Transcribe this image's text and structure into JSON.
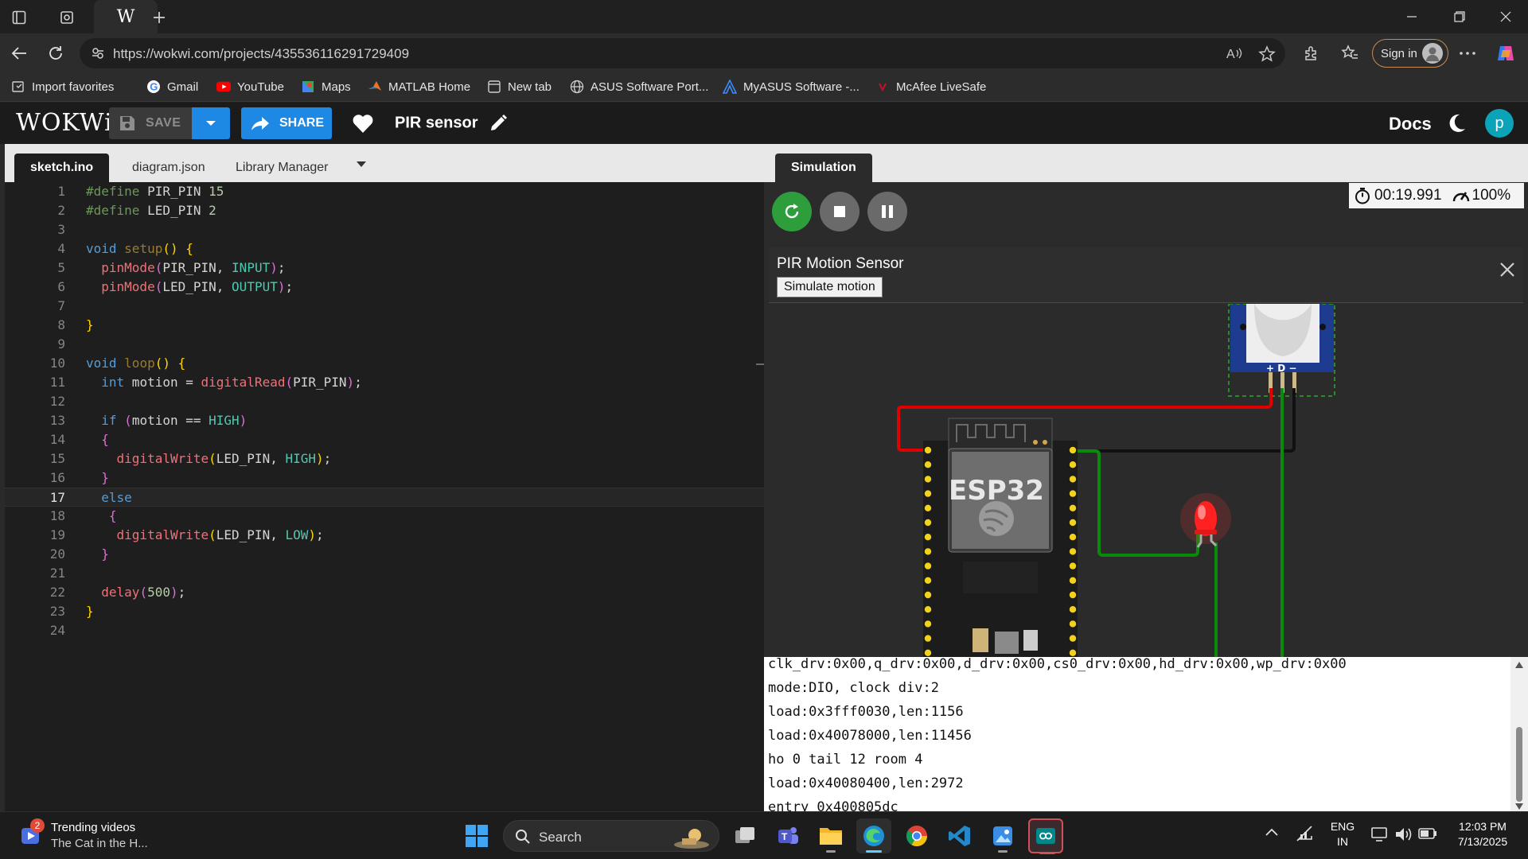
{
  "browser": {
    "url": "https://wokwi.com/projects/435536116291729409",
    "sign_in_label": "Sign in",
    "bookmarks": [
      {
        "label": "Import favorites",
        "icon": "import-icon"
      },
      {
        "label": "Gmail",
        "icon": "google-icon"
      },
      {
        "label": "YouTube",
        "icon": "youtube-icon"
      },
      {
        "label": "Maps",
        "icon": "maps-icon"
      },
      {
        "label": "MATLAB Home",
        "icon": "matlab-icon"
      },
      {
        "label": "New tab",
        "icon": "new-tab-icon"
      },
      {
        "label": "ASUS Software Port...",
        "icon": "globe-icon"
      },
      {
        "label": "MyASUS Software -...",
        "icon": "myasus-icon"
      },
      {
        "label": "McAfee LiveSafe",
        "icon": "mcafee-icon"
      }
    ]
  },
  "wokwi": {
    "logo": "WOKWi",
    "save_label": "SAVE",
    "share_label": "SHARE",
    "project_title": "PIR sensor",
    "docs_label": "Docs",
    "avatar_letter": "p"
  },
  "editor": {
    "tabs": [
      "sketch.ino",
      "diagram.json",
      "Library Manager"
    ],
    "active_tab": "sketch.ino",
    "current_line": 17,
    "lines": [
      "#define PIR_PIN 15",
      "#define LED_PIN 2",
      "",
      "void setup() {",
      "  pinMode(PIR_PIN, INPUT);",
      "  pinMode(LED_PIN, OUTPUT);",
      "",
      "}",
      "",
      "void loop() {",
      "  int motion = digitalRead(PIR_PIN);",
      "",
      "  if (motion == HIGH)",
      "  {",
      "    digitalWrite(LED_PIN, HIGH);",
      "  }",
      "  else",
      "   {",
      "    digitalWrite(LED_PIN, LOW);",
      "  }",
      "",
      "  delay(500);",
      "}",
      ""
    ]
  },
  "simulation": {
    "tab_label": "Simulation",
    "timer": "00:19.991",
    "speed": "100%",
    "panel_title": "PIR Motion Sensor",
    "simulate_button": "Simulate motion",
    "board_label": "ESP32",
    "pir_pins": "+ D −",
    "serial_lines": [
      "clk_drv:0x00,q_drv:0x00,d_drv:0x00,cs0_drv:0x00,hd_drv:0x00,wp_drv:0x00",
      "mode:DIO, clock div:2",
      "load:0x3fff0030,len:1156",
      "load:0x40078000,len:11456",
      "ho 0 tail 12 room 4",
      "load:0x40080400,len:2972",
      "entry 0x400805dc"
    ],
    "colors": {
      "wire_vcc": "#e00000",
      "wire_gnd": "#111111",
      "wire_signal": "#0a8a0a",
      "led": "#ff2020"
    }
  },
  "taskbar": {
    "widget_badge": "2",
    "widget_title": "Trending videos",
    "widget_subtitle": "The Cat in the H...",
    "search_label": "Search",
    "lang_top": "ENG",
    "lang_bottom": "IN",
    "time": "12:03 PM",
    "date": "7/13/2025"
  }
}
